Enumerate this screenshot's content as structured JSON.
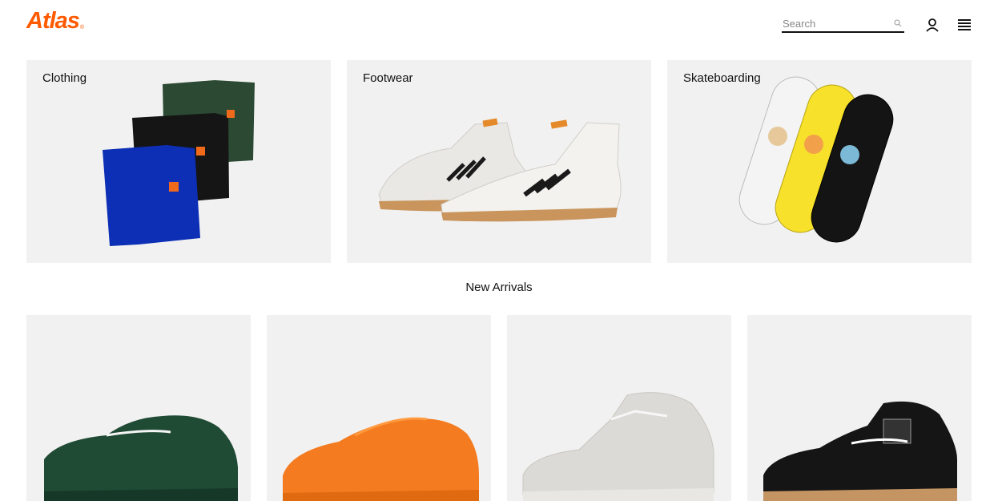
{
  "header": {
    "logo": "Atlas",
    "logo_mark": "®",
    "search_placeholder": "Search",
    "icons": [
      "search-icon",
      "account-icon",
      "menu-icon"
    ]
  },
  "categories": [
    {
      "label": "Clothing"
    },
    {
      "label": "Footwear"
    },
    {
      "label": "Skateboarding"
    }
  ],
  "new_arrivals": {
    "title": "New Arrivals",
    "products": [
      {
        "color": "#1f4a34"
      },
      {
        "color": "#f47b20"
      },
      {
        "color": "#dcdad6"
      },
      {
        "color": "#151515"
      }
    ]
  },
  "colors": {
    "brand": "#ff5a00",
    "tile_bg": "#f1f1f1"
  }
}
